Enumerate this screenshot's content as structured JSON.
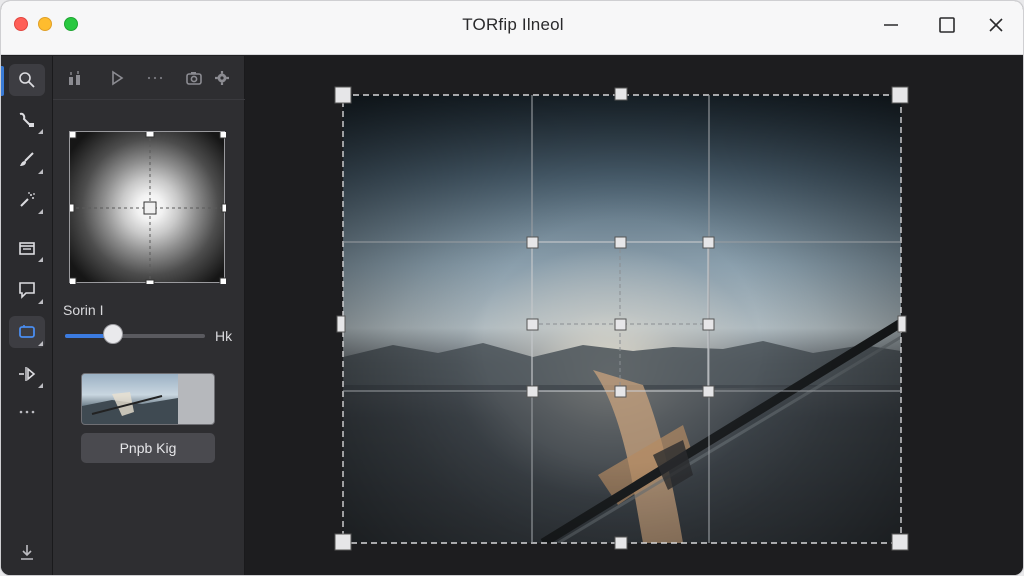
{
  "window": {
    "title": "TORfip Ilneol"
  },
  "panel": {
    "slider_label": "Sorin I",
    "slider_value": "Hk",
    "slider_fraction": 0.34,
    "export_label": "Pnpb Kig"
  },
  "tools": [
    {
      "name": "zoom-tool",
      "icon": "magnifier-icon",
      "active": false
    },
    {
      "name": "path-tool",
      "icon": "pen-path-icon",
      "active": false
    },
    {
      "name": "brush-tool",
      "icon": "brush-icon",
      "active": false
    },
    {
      "name": "spray-tool",
      "icon": "spray-icon",
      "active": false
    },
    {
      "name": "layers-tool",
      "icon": "layers-icon",
      "active": false
    },
    {
      "name": "comment-tool",
      "icon": "comment-icon",
      "active": false
    },
    {
      "name": "transform-tool",
      "icon": "transform-icon",
      "active": true
    },
    {
      "name": "flip-tool",
      "icon": "flip-icon",
      "active": false
    },
    {
      "name": "more-tools",
      "icon": "ellipsis-icon",
      "active": false
    },
    {
      "name": "download-tool",
      "icon": "download-icon",
      "active": false
    }
  ],
  "colors": {
    "accent": "#3b7be0",
    "panel_bg": "#2e2e31",
    "canvas_bg": "#1d1d1f",
    "titlebar_bg": "#f7f7f8"
  }
}
